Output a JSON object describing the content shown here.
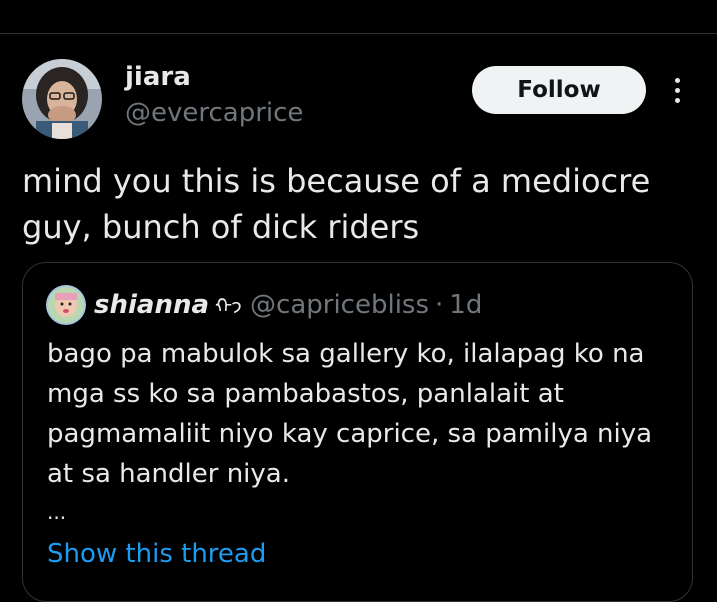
{
  "tweet": {
    "author": {
      "name": "jiara",
      "handle": "@evercaprice",
      "avatar": "profile-photo"
    },
    "follow_label": "Follow",
    "more_icon": "more-vertical-icon",
    "text": "mind you this is because of a mediocre guy, bunch of dick riders"
  },
  "quote": {
    "author": {
      "name": "shianna",
      "emoji": "ᡣ𐭩",
      "handle": "@capricebliss",
      "separator": "·",
      "time": "1d",
      "avatar": "profile-photo"
    },
    "text": "bago pa mabulok sa gallery ko, ilalapag ko na mga ss ko sa pambabastos, panlalait at pagmamaliit niyo kay caprice, sa pamilya niya at sa handler niya.",
    "ellipsis": "...",
    "show_thread_label": "Show this thread"
  },
  "colors": {
    "background": "#000000",
    "primary_text": "#e7e9ea",
    "secondary_text": "#71767b",
    "link": "#1d9bf0",
    "border": "#2f3336",
    "follow_button_bg": "#eff3f4"
  }
}
